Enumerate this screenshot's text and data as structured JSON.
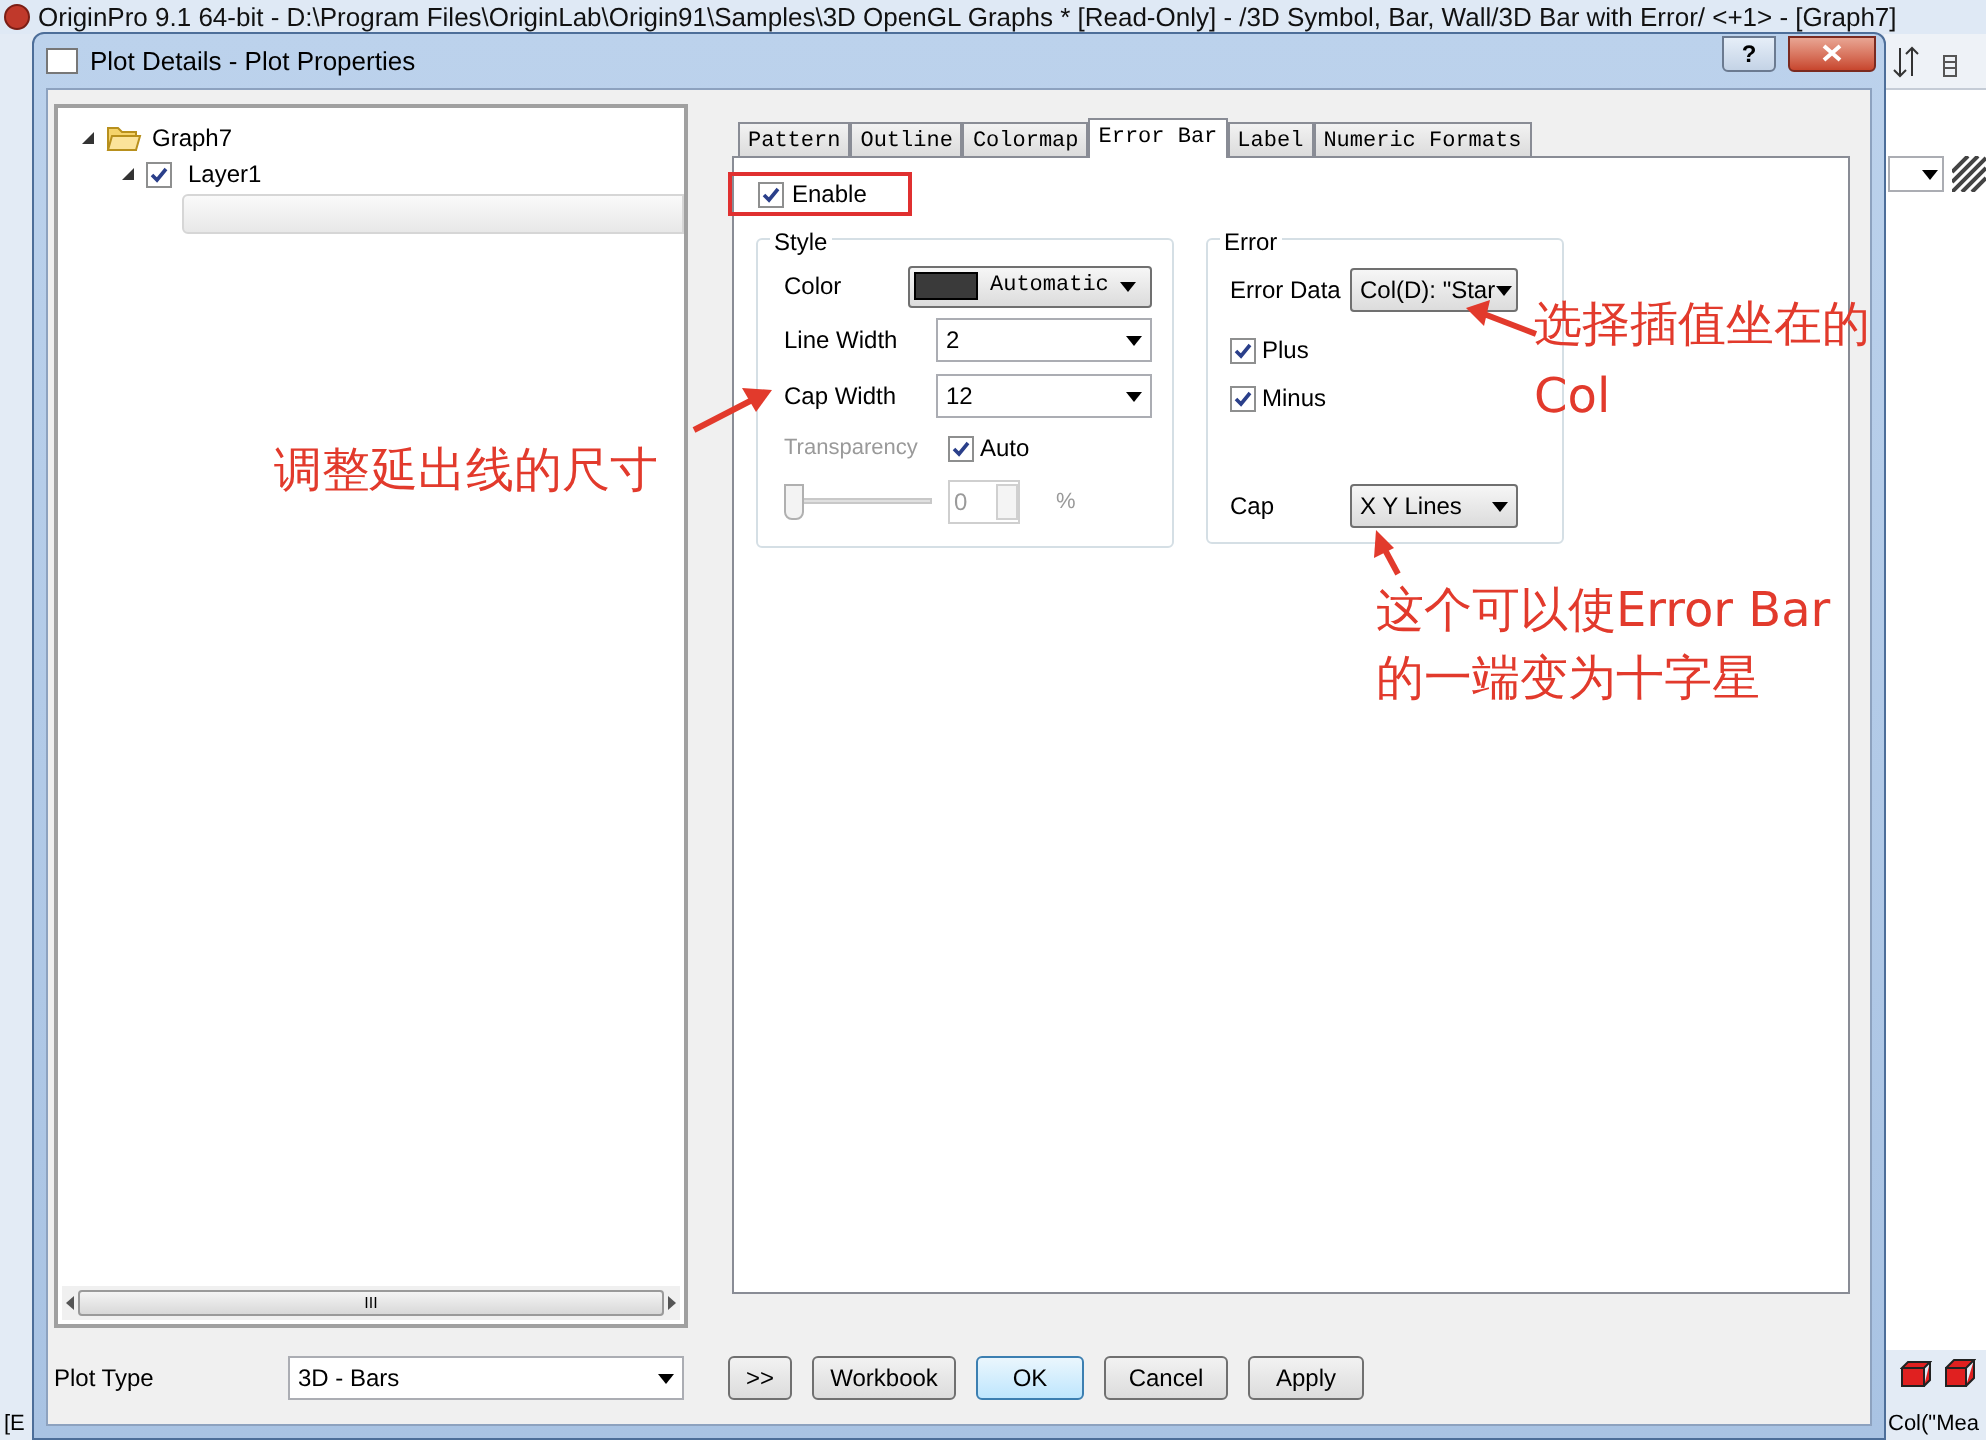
{
  "app": {
    "title": "OriginPro 9.1 64-bit - D:\\Program Files\\OriginLab\\Origin91\\Samples\\3D OpenGL Graphs * [Read-Only] - /3D Symbol, Bar, Wall/3D Bar with Error/ <+1> - [Graph7]",
    "status_left": "[E",
    "status_right": "Col(\"Mea"
  },
  "dialog": {
    "title": "Plot Details - Plot Properties",
    "help": "?"
  },
  "tree": [
    {
      "label": "Graph7",
      "kind": "folder",
      "expanded": true,
      "children": [
        {
          "label": "Layer1",
          "kind": "layer",
          "checked": true,
          "expanded": true
        }
      ]
    }
  ],
  "tree_scroll": {
    "grip": "III"
  },
  "tabs": [
    {
      "label": "Pattern",
      "selected": false
    },
    {
      "label": "Outline",
      "selected": false
    },
    {
      "label": "Colormap",
      "selected": false
    },
    {
      "label": "Error Bar",
      "selected": true
    },
    {
      "label": "Label",
      "selected": false
    },
    {
      "label": "Numeric Formats",
      "selected": false
    }
  ],
  "enable": {
    "label": "Enable",
    "checked": true
  },
  "style": {
    "title": "Style",
    "color": {
      "label": "Color",
      "value": "Automatic"
    },
    "line_width": {
      "label": "Line Width",
      "value": "2"
    },
    "cap_width": {
      "label": "Cap Width",
      "value": "12"
    },
    "transparency": {
      "label": "Transparency",
      "disabled": true,
      "level": 0,
      "value": "0",
      "unit": "%"
    },
    "auto": {
      "label": "Auto",
      "checked": true
    }
  },
  "error": {
    "title": "Error",
    "error_data": {
      "label": "Error Data",
      "value": "Col(D): \"Star"
    },
    "plus": {
      "label": "Plus",
      "checked": true
    },
    "minus": {
      "label": "Minus",
      "checked": true
    },
    "cap": {
      "label": "Cap",
      "value": "X Y Lines"
    }
  },
  "plot_type": {
    "label": "Plot Type",
    "value": "3D - Bars"
  },
  "buttons": [
    {
      "label": ">>",
      "default": false
    },
    {
      "label": "Workbook",
      "default": false
    },
    {
      "label": "OK",
      "default": true
    },
    {
      "label": "Cancel",
      "default": false
    },
    {
      "label": "Apply",
      "default": false
    }
  ],
  "annotations": [
    {
      "lines": [
        "调整延出线的尺寸"
      ]
    },
    {
      "lines": [
        "选择插值坐在的",
        "Col"
      ]
    },
    {
      "lines": [
        "这个可以使Error Bar",
        "的一端变为十字星"
      ]
    }
  ]
}
